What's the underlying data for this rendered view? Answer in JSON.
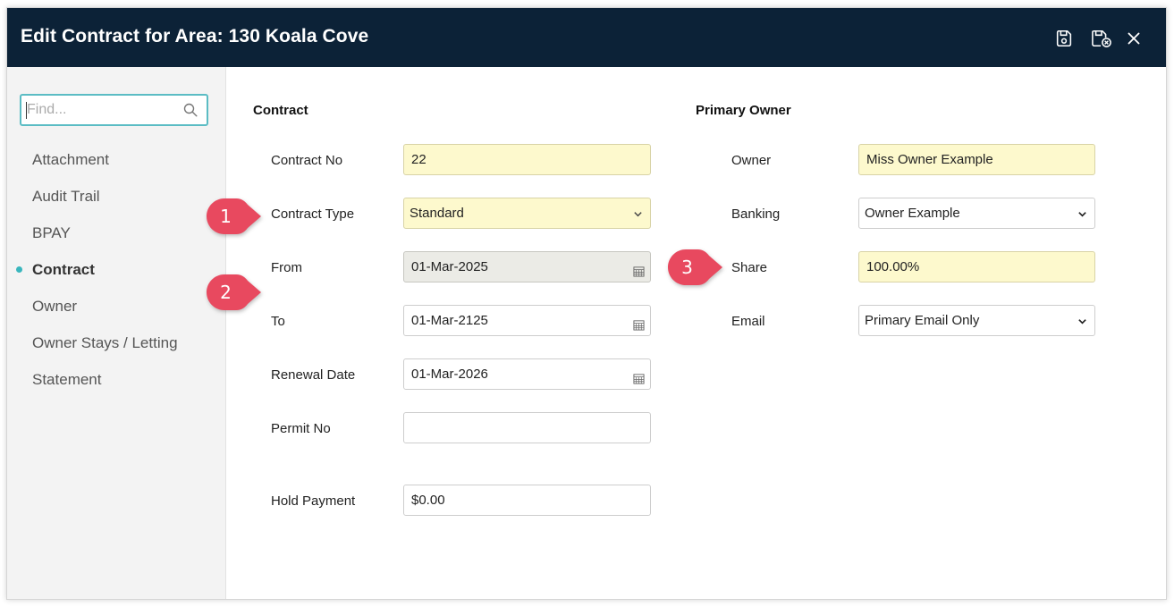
{
  "window": {
    "title": "Edit Contract for Area: 130 Koala Cove",
    "toolbar": {
      "save_icon": "save-icon",
      "save_close_icon": "save-close-icon",
      "close_icon": "close-icon"
    }
  },
  "sidebar": {
    "search_placeholder": "Find...",
    "items": [
      {
        "label": "Attachment",
        "active": false
      },
      {
        "label": "Audit Trail",
        "active": false
      },
      {
        "label": "BPAY",
        "active": false
      },
      {
        "label": "Contract",
        "active": true
      },
      {
        "label": "Owner",
        "active": false
      },
      {
        "label": "Owner Stays / Letting",
        "active": false
      },
      {
        "label": "Statement",
        "active": false
      }
    ]
  },
  "contract": {
    "heading": "Contract",
    "contract_no": {
      "label": "Contract No",
      "value": "22"
    },
    "contract_type": {
      "label": "Contract Type",
      "value": "Standard"
    },
    "from": {
      "label": "From",
      "value": "01-Mar-2025"
    },
    "to": {
      "label": "To",
      "value": "01-Mar-2125"
    },
    "renewal_date": {
      "label": "Renewal Date",
      "value": "01-Mar-2026"
    },
    "permit_no": {
      "label": "Permit No",
      "value": ""
    },
    "hold_payment": {
      "label": "Hold Payment",
      "value": "$0.00"
    }
  },
  "primary_owner": {
    "heading": "Primary Owner",
    "owner": {
      "label": "Owner",
      "value": "Miss Owner Example"
    },
    "banking": {
      "label": "Banking",
      "value": "Owner Example"
    },
    "share": {
      "label": "Share",
      "value": "100.00%"
    },
    "email": {
      "label": "Email",
      "value": "Primary Email Only"
    }
  },
  "callouts": [
    "1",
    "2",
    "3"
  ],
  "colors": {
    "titlebar": "#0c2237",
    "accent": "#39b6bd",
    "callout": "#e8495f",
    "required_field": "#fdf9cd",
    "readonly_field": "#ebebe6"
  }
}
